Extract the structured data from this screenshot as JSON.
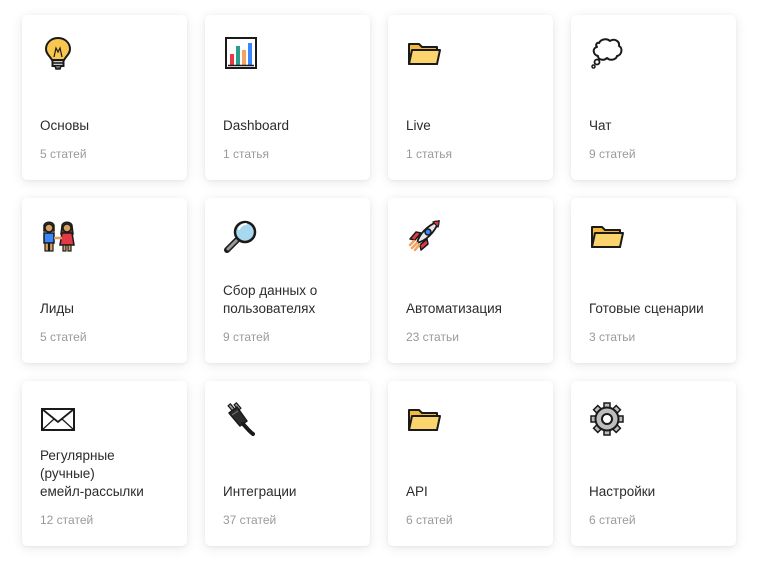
{
  "cards": [
    {
      "title": "Основы",
      "count": "5 статей",
      "icon": "lightbulb-icon"
    },
    {
      "title": "Dashboard",
      "count": "1 статья",
      "icon": "bar-chart-icon"
    },
    {
      "title": "Live",
      "count": "1 статья",
      "icon": "folder-icon"
    },
    {
      "title": "Чат",
      "count": "9 статей",
      "icon": "speech-bubble-icon"
    },
    {
      "title": "Лиды",
      "count": "5 статей",
      "icon": "people-icon"
    },
    {
      "title": "Сбор данных о\nпользователях",
      "count": "9 статей",
      "icon": "magnifier-icon"
    },
    {
      "title": "Автоматизация",
      "count": "23 статьи",
      "icon": "rocket-icon"
    },
    {
      "title": "Готовые сценарии",
      "count": "3 статьи",
      "icon": "folder-icon"
    },
    {
      "title": "Регулярные\n(ручные)\nемейл-рассылки",
      "count": "12 статей",
      "icon": "envelope-icon"
    },
    {
      "title": "Интеграции",
      "count": "37 статей",
      "icon": "plug-icon"
    },
    {
      "title": "API",
      "count": "6 статей",
      "icon": "folder-icon"
    },
    {
      "title": "Настройки",
      "count": "6 статей",
      "icon": "gear-icon"
    }
  ],
  "colors": {
    "card_bg": "#ffffff",
    "title": "#2b2b2b",
    "count": "#9a9a9a",
    "folder": "#f7c64a"
  }
}
